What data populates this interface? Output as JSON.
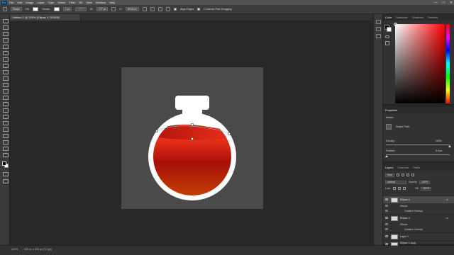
{
  "app": {
    "logo": "Ps"
  },
  "menu": [
    "File",
    "Edit",
    "Image",
    "Layer",
    "Type",
    "Select",
    "Filter",
    "3D",
    "View",
    "Window",
    "Help"
  ],
  "window_controls": {
    "minimize": "—",
    "maximize": "□",
    "close": "✕"
  },
  "options": {
    "mode_label": "Shape",
    "fill_label": "Fill:",
    "stroke_label": "Stroke:",
    "stroke_width": "1 px",
    "w_label": "W:",
    "w_value": "177 px",
    "h_label": "H:",
    "h_value": "89.46 px",
    "align_edges": "Align Edges",
    "constrain": "Constrain Path Dragging"
  },
  "document": {
    "tab_title": "Untitled-1 @ 100% (Ellipse 4, RGB/8)"
  },
  "status": {
    "zoom": "100%",
    "doc_size": "600 px x 600 px (72 ppi)"
  },
  "color_panel": {
    "tabs": [
      "Color",
      "Swatches",
      "Gradients",
      "Patterns"
    ],
    "active": 0
  },
  "properties_panel": {
    "tabs": [
      "Properties"
    ],
    "section": "Masks",
    "mask_label": "Shape Path",
    "density_label": "Density:",
    "density_value": "100%",
    "feather_label": "Feather:",
    "feather_value": "0.0 px"
  },
  "layers_panel": {
    "tabs": [
      "Layers",
      "Channels",
      "Paths"
    ],
    "active": 0,
    "filter_kind": "Kind",
    "blend_mode": "Normal",
    "opacity_label": "Opacity:",
    "opacity_value": "100%",
    "lock_label": "Lock:",
    "fill_label": "Fill:",
    "fill_value": "100%",
    "layers": [
      {
        "name": "Ellipse 4",
        "fx": "fx",
        "effects": "Effects",
        "effect": "Gradient Overlay",
        "selected": true
      },
      {
        "name": "Ellipse 3",
        "fx": "fx",
        "effects": "Effects",
        "effect": "Gradient Overlay",
        "selected": false
      },
      {
        "name": "Layer 1",
        "selected": false
      },
      {
        "name": "Ellipse 2 copy",
        "selected": false
      }
    ]
  },
  "colors": {
    "accent": "#31a8ff",
    "liquid_top": "#ff3b1f",
    "liquid_bottom": "#c44a00",
    "artboard": "#4a4a4a"
  }
}
